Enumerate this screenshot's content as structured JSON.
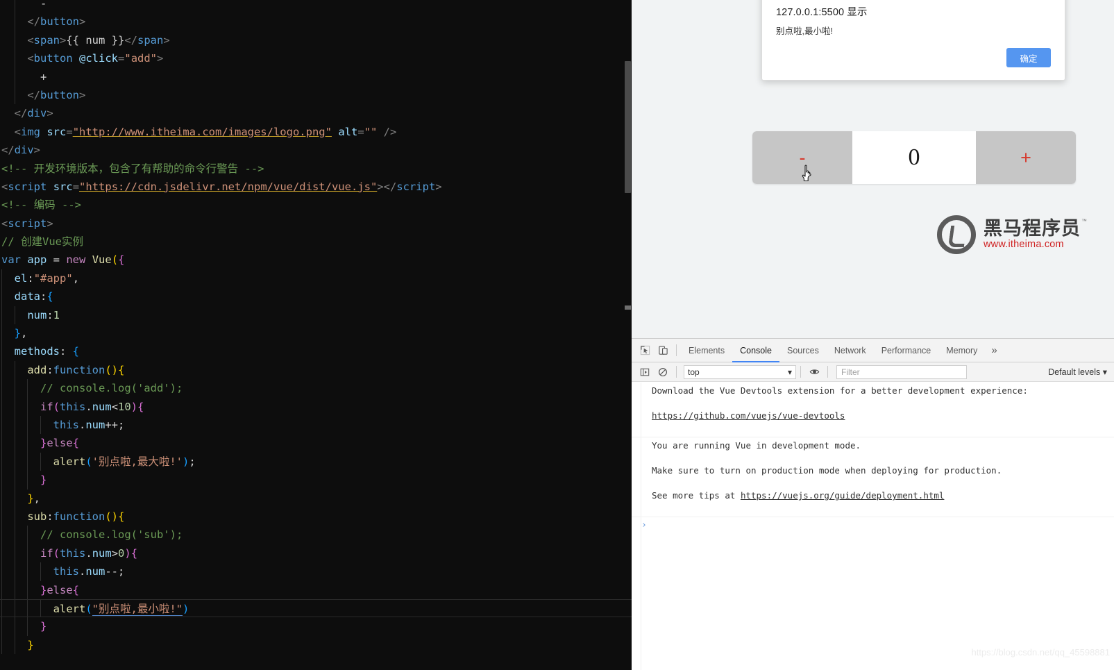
{
  "editor": {
    "language": "html",
    "lines": [
      {
        "indent_guides": [
          1
        ],
        "tokens": [
          {
            "c": "t-plain",
            "t": "      -"
          }
        ]
      },
      {
        "indent_guides": [
          1
        ],
        "tokens": [
          {
            "c": "t-punct",
            "t": "    </"
          },
          {
            "c": "t-tag",
            "t": "button"
          },
          {
            "c": "t-punct",
            "t": ">"
          }
        ]
      },
      {
        "indent_guides": [
          1
        ],
        "tokens": [
          {
            "c": "t-punct",
            "t": "    <"
          },
          {
            "c": "t-tag",
            "t": "span"
          },
          {
            "c": "t-punct",
            "t": ">"
          },
          {
            "c": "t-mustache",
            "t": "{{ num }}"
          },
          {
            "c": "t-punct",
            "t": "</"
          },
          {
            "c": "t-tag",
            "t": "span"
          },
          {
            "c": "t-punct",
            "t": ">"
          }
        ]
      },
      {
        "indent_guides": [
          1
        ],
        "tokens": [
          {
            "c": "t-punct",
            "t": "    <"
          },
          {
            "c": "t-tag",
            "t": "button"
          },
          {
            "c": "t-plain",
            "t": " "
          },
          {
            "c": "t-attr",
            "t": "@click"
          },
          {
            "c": "t-punct",
            "t": "="
          },
          {
            "c": "t-str",
            "t": "\"add\""
          },
          {
            "c": "t-punct",
            "t": ">"
          }
        ]
      },
      {
        "indent_guides": [
          1
        ],
        "tokens": [
          {
            "c": "t-plain",
            "t": "      +"
          }
        ]
      },
      {
        "indent_guides": [
          1
        ],
        "tokens": [
          {
            "c": "t-punct",
            "t": "    </"
          },
          {
            "c": "t-tag",
            "t": "button"
          },
          {
            "c": "t-punct",
            "t": ">"
          }
        ]
      },
      {
        "indent_guides": [],
        "tokens": [
          {
            "c": "t-punct",
            "t": "  </"
          },
          {
            "c": "t-tag",
            "t": "div"
          },
          {
            "c": "t-punct",
            "t": ">"
          }
        ]
      },
      {
        "indent_guides": [],
        "tokens": [
          {
            "c": "t-punct",
            "t": "  <"
          },
          {
            "c": "t-tag",
            "t": "img"
          },
          {
            "c": "t-plain",
            "t": " "
          },
          {
            "c": "t-attr",
            "t": "src"
          },
          {
            "c": "t-punct",
            "t": "="
          },
          {
            "c": "t-link",
            "t": "\"http://www.itheima.com/images/logo.png\""
          },
          {
            "c": "t-plain",
            "t": " "
          },
          {
            "c": "t-attr",
            "t": "alt"
          },
          {
            "c": "t-punct",
            "t": "="
          },
          {
            "c": "t-str",
            "t": "\"\""
          },
          {
            "c": "t-plain",
            "t": " "
          },
          {
            "c": "t-punct",
            "t": "/>"
          }
        ]
      },
      {
        "indent_guides": [],
        "tokens": [
          {
            "c": "t-punct",
            "t": "</"
          },
          {
            "c": "t-tag",
            "t": "div"
          },
          {
            "c": "t-punct",
            "t": ">"
          }
        ]
      },
      {
        "indent_guides": [],
        "tokens": [
          {
            "c": "t-comment",
            "t": "<!-- 开发环境版本，包含了有帮助的命令行警告 -->"
          }
        ]
      },
      {
        "indent_guides": [],
        "tokens": [
          {
            "c": "t-punct",
            "t": "<"
          },
          {
            "c": "t-tag",
            "t": "script"
          },
          {
            "c": "t-plain",
            "t": " "
          },
          {
            "c": "t-attr",
            "t": "src"
          },
          {
            "c": "t-punct",
            "t": "="
          },
          {
            "c": "t-link",
            "t": "\"https://cdn.jsdelivr.net/npm/vue/dist/vue.js\""
          },
          {
            "c": "t-punct",
            "t": "></"
          },
          {
            "c": "t-tag",
            "t": "script"
          },
          {
            "c": "t-punct",
            "t": ">"
          }
        ]
      },
      {
        "indent_guides": [],
        "tokens": [
          {
            "c": "t-comment",
            "t": "<!-- 编码 -->"
          }
        ]
      },
      {
        "indent_guides": [],
        "tokens": [
          {
            "c": "t-punct",
            "t": "<"
          },
          {
            "c": "t-tag",
            "t": "script"
          },
          {
            "c": "t-punct",
            "t": ">"
          }
        ]
      },
      {
        "indent_guides": [],
        "tokens": [
          {
            "c": "t-comment",
            "t": "// 创建Vue实例"
          }
        ]
      },
      {
        "indent_guides": [],
        "tokens": [
          {
            "c": "t-key",
            "t": "var"
          },
          {
            "c": "t-plain",
            "t": " "
          },
          {
            "c": "t-var",
            "t": "app"
          },
          {
            "c": "t-plain",
            "t": " = "
          },
          {
            "c": "t-kw",
            "t": "new"
          },
          {
            "c": "t-plain",
            "t": " "
          },
          {
            "c": "t-fn",
            "t": "Vue"
          },
          {
            "c": "t-brace",
            "t": "("
          },
          {
            "c": "t-brace2",
            "t": "{"
          }
        ]
      },
      {
        "indent_guides": [
          0
        ],
        "tokens": [
          {
            "c": "t-plain",
            "t": "  "
          },
          {
            "c": "t-prop",
            "t": "el"
          },
          {
            "c": "t-plain",
            "t": ":"
          },
          {
            "c": "t-str",
            "t": "\"#app\""
          },
          {
            "c": "t-plain",
            "t": ","
          }
        ]
      },
      {
        "indent_guides": [
          0
        ],
        "tokens": [
          {
            "c": "t-plain",
            "t": "  "
          },
          {
            "c": "t-prop",
            "t": "data"
          },
          {
            "c": "t-plain",
            "t": ":"
          },
          {
            "c": "t-brace3",
            "t": "{"
          }
        ]
      },
      {
        "indent_guides": [
          0,
          1
        ],
        "tokens": [
          {
            "c": "t-plain",
            "t": "    "
          },
          {
            "c": "t-prop",
            "t": "num"
          },
          {
            "c": "t-plain",
            "t": ":"
          },
          {
            "c": "t-num",
            "t": "1"
          }
        ]
      },
      {
        "indent_guides": [
          0
        ],
        "tokens": [
          {
            "c": "t-plain",
            "t": "  "
          },
          {
            "c": "t-brace3",
            "t": "}"
          },
          {
            "c": "t-plain",
            "t": ","
          }
        ]
      },
      {
        "indent_guides": [
          0
        ],
        "tokens": [
          {
            "c": "t-plain",
            "t": "  "
          },
          {
            "c": "t-prop",
            "t": "methods"
          },
          {
            "c": "t-plain",
            "t": ": "
          },
          {
            "c": "t-brace3",
            "t": "{"
          }
        ]
      },
      {
        "indent_guides": [
          0,
          1
        ],
        "tokens": [
          {
            "c": "t-plain",
            "t": "    "
          },
          {
            "c": "t-fn",
            "t": "add"
          },
          {
            "c": "t-plain",
            "t": ":"
          },
          {
            "c": "t-key",
            "t": "function"
          },
          {
            "c": "t-brace",
            "t": "()"
          },
          {
            "c": "t-brace",
            "t": "{"
          }
        ]
      },
      {
        "indent_guides": [
          0,
          1,
          2
        ],
        "tokens": [
          {
            "c": "t-plain",
            "t": "      "
          },
          {
            "c": "t-comment",
            "t": "// console.log('add');"
          }
        ]
      },
      {
        "indent_guides": [
          0,
          1,
          2
        ],
        "tokens": [
          {
            "c": "t-plain",
            "t": "      "
          },
          {
            "c": "t-kw",
            "t": "if"
          },
          {
            "c": "t-brace2",
            "t": "("
          },
          {
            "c": "t-key",
            "t": "this"
          },
          {
            "c": "t-plain",
            "t": "."
          },
          {
            "c": "t-prop",
            "t": "num"
          },
          {
            "c": "t-plain",
            "t": "<"
          },
          {
            "c": "t-num",
            "t": "10"
          },
          {
            "c": "t-brace2",
            "t": ")"
          },
          {
            "c": "t-brace2",
            "t": "{"
          }
        ]
      },
      {
        "indent_guides": [
          0,
          1,
          2,
          3
        ],
        "tokens": [
          {
            "c": "t-plain",
            "t": "        "
          },
          {
            "c": "t-key",
            "t": "this"
          },
          {
            "c": "t-plain",
            "t": "."
          },
          {
            "c": "t-prop",
            "t": "num"
          },
          {
            "c": "t-plain",
            "t": "++;"
          }
        ]
      },
      {
        "indent_guides": [
          0,
          1,
          2
        ],
        "tokens": [
          {
            "c": "t-plain",
            "t": "      "
          },
          {
            "c": "t-brace2",
            "t": "}"
          },
          {
            "c": "t-kw",
            "t": "else"
          },
          {
            "c": "t-brace2",
            "t": "{"
          }
        ]
      },
      {
        "indent_guides": [
          0,
          1,
          2,
          3
        ],
        "tokens": [
          {
            "c": "t-plain",
            "t": "        "
          },
          {
            "c": "t-fn",
            "t": "alert"
          },
          {
            "c": "t-brace3",
            "t": "("
          },
          {
            "c": "t-str",
            "t": "'别点啦,最大啦!'"
          },
          {
            "c": "t-brace3",
            "t": ")"
          },
          {
            "c": "t-plain",
            "t": ";"
          }
        ]
      },
      {
        "indent_guides": [
          0,
          1,
          2
        ],
        "tokens": [
          {
            "c": "t-plain",
            "t": "      "
          },
          {
            "c": "t-brace2",
            "t": "}"
          }
        ]
      },
      {
        "indent_guides": [
          0,
          1
        ],
        "tokens": [
          {
            "c": "t-plain",
            "t": "    "
          },
          {
            "c": "t-brace",
            "t": "}"
          },
          {
            "c": "t-plain",
            "t": ","
          }
        ]
      },
      {
        "indent_guides": [
          0,
          1
        ],
        "tokens": [
          {
            "c": "t-plain",
            "t": "    "
          },
          {
            "c": "t-fn",
            "t": "sub"
          },
          {
            "c": "t-plain",
            "t": ":"
          },
          {
            "c": "t-key",
            "t": "function"
          },
          {
            "c": "t-brace",
            "t": "()"
          },
          {
            "c": "t-brace",
            "t": "{"
          }
        ]
      },
      {
        "indent_guides": [
          0,
          1,
          2
        ],
        "tokens": [
          {
            "c": "t-plain",
            "t": "      "
          },
          {
            "c": "t-comment",
            "t": "// console.log('sub');"
          }
        ]
      },
      {
        "indent_guides": [
          0,
          1,
          2
        ],
        "tokens": [
          {
            "c": "t-plain",
            "t": "      "
          },
          {
            "c": "t-kw",
            "t": "if"
          },
          {
            "c": "t-brace2",
            "t": "("
          },
          {
            "c": "t-key",
            "t": "this"
          },
          {
            "c": "t-plain",
            "t": "."
          },
          {
            "c": "t-prop",
            "t": "num"
          },
          {
            "c": "t-plain",
            "t": ">"
          },
          {
            "c": "t-num",
            "t": "0"
          },
          {
            "c": "t-brace2",
            "t": ")"
          },
          {
            "c": "t-brace2",
            "t": "{"
          }
        ]
      },
      {
        "indent_guides": [
          0,
          1,
          2,
          3
        ],
        "tokens": [
          {
            "c": "t-plain",
            "t": "        "
          },
          {
            "c": "t-key",
            "t": "this"
          },
          {
            "c": "t-plain",
            "t": "."
          },
          {
            "c": "t-prop",
            "t": "num"
          },
          {
            "c": "t-plain",
            "t": "--;"
          }
        ]
      },
      {
        "indent_guides": [
          0,
          1,
          2
        ],
        "tokens": [
          {
            "c": "t-plain",
            "t": "      "
          },
          {
            "c": "t-brace2",
            "t": "}"
          },
          {
            "c": "t-kw",
            "t": "else"
          },
          {
            "c": "t-brace2",
            "t": "{"
          }
        ]
      },
      {
        "indent_guides": [
          0,
          1,
          2,
          3
        ],
        "current": true,
        "tokens": [
          {
            "c": "t-plain",
            "t": "        "
          },
          {
            "c": "t-fn",
            "t": "alert"
          },
          {
            "c": "t-brace3",
            "t": "("
          },
          {
            "c": "t-str2",
            "t": "\"别点啦,最小啦!\""
          },
          {
            "c": "t-brace3",
            "t": ")"
          }
        ]
      },
      {
        "indent_guides": [
          0,
          1,
          2
        ],
        "tokens": [
          {
            "c": "t-plain",
            "t": "      "
          },
          {
            "c": "t-brace2",
            "t": "}"
          }
        ]
      },
      {
        "indent_guides": [
          0,
          1
        ],
        "tokens": [
          {
            "c": "t-plain",
            "t": "    "
          },
          {
            "c": "t-brace",
            "t": "}"
          }
        ]
      }
    ]
  },
  "browser": {
    "alert": {
      "origin": "127.0.0.1:5500 显示",
      "message": "别点啦,最小啦!",
      "ok_label": "确定",
      "ok_color": "#5596f0"
    },
    "counter": {
      "minus_label": "-",
      "value": "0",
      "plus_label": "+",
      "button_color": "#c6c6c6",
      "sign_color": "#d63b2f"
    },
    "logo": {
      "brand_cn": "黑马程序员",
      "url": "www.itheima.com",
      "trademark": "™",
      "url_color": "#cf2222"
    }
  },
  "devtools": {
    "tabs": [
      {
        "label": "Elements",
        "active": false
      },
      {
        "label": "Console",
        "active": true
      },
      {
        "label": "Sources",
        "active": false
      },
      {
        "label": "Network",
        "active": false
      },
      {
        "label": "Performance",
        "active": false
      },
      {
        "label": "Memory",
        "active": false
      }
    ],
    "overflow_label": "»",
    "accent_color": "#4285f4",
    "filterbar": {
      "context": "top",
      "context_caret": "▾",
      "filter_placeholder": "Filter",
      "levels_label": "Default levels ▾"
    },
    "console": {
      "messages": [
        {
          "line1": "Download the Vue Devtools extension for a better development experience:",
          "link1": "https://github.com/vuejs/vue-devtools"
        },
        {
          "line1": "You are running Vue in development mode.",
          "line2": "Make sure to turn on production mode when deploying for production.",
          "line3_prefix": "See more tips at ",
          "link1": "https://vuejs.org/guide/deployment.html"
        }
      ],
      "prompt": "›"
    }
  },
  "watermark": {
    "text": "https://blog.csdn.net/qq_45598881"
  }
}
